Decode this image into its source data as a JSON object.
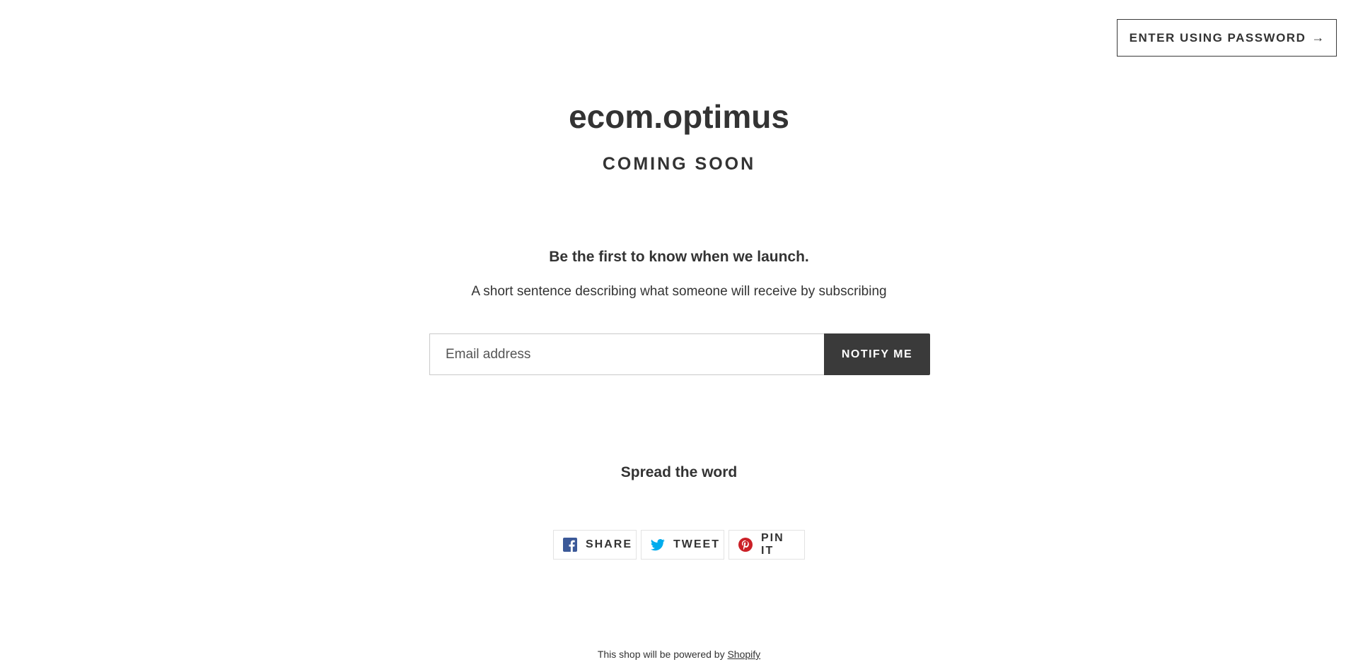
{
  "header": {
    "password_button_label": "ENTER USING PASSWORD",
    "password_button_arrow": "→",
    "shop_name": "ecom.optimus",
    "tagline": "COMING SOON"
  },
  "newsletter": {
    "heading": "Be the first to know when we launch.",
    "description": "A short sentence describing what someone will receive by subscribing",
    "email_placeholder": "Email address",
    "email_value": "",
    "submit_label": "NOTIFY ME"
  },
  "share": {
    "heading": "Spread the word",
    "buttons": [
      {
        "label": "SHARE",
        "icon": "facebook-icon",
        "color": "#3b5998"
      },
      {
        "label": "TWEET",
        "icon": "twitter-icon",
        "color": "#00aced"
      },
      {
        "label": "PIN IT",
        "icon": "pinterest-icon",
        "color": "#cb2027"
      }
    ]
  },
  "footer": {
    "text": "This shop will be powered by",
    "link_label": "Shopify"
  },
  "colors": {
    "text": "#333333",
    "button_dark": "#3a3a3a",
    "background": "#ffffff"
  }
}
